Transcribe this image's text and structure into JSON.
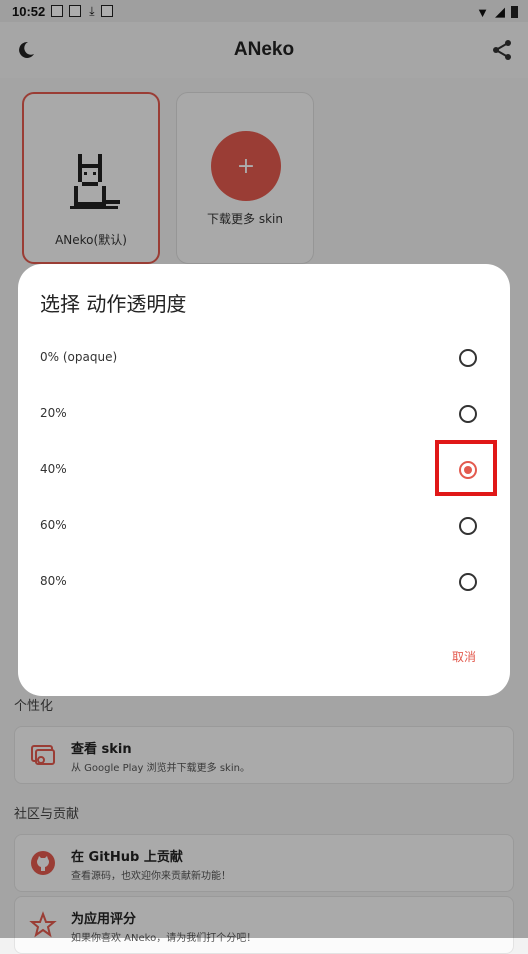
{
  "status_bar": {
    "time": "10:52"
  },
  "app_bar": {
    "title": "ANeko",
    "left_icon": "night-mode-icon",
    "right_icon": "share-icon"
  },
  "skins": [
    {
      "label": "ANeko(默认)",
      "selected": true
    },
    {
      "label": "下载更多 skin",
      "add_symbol": "+"
    }
  ],
  "sections": {
    "personalize": {
      "title": "个性化",
      "items": [
        {
          "title": "查看 skin",
          "subtitle": "从 Google Play 浏览并下载更多 skin。",
          "icon": "skin-browse-icon"
        }
      ]
    },
    "community": {
      "title": "社区与贡献",
      "items": [
        {
          "title": "在 GitHub 上贡献",
          "subtitle": "查看源码，也欢迎你来贡献新功能！",
          "icon": "github-icon"
        },
        {
          "title": "为应用评分",
          "subtitle": "如果你喜欢 ANeko，请为我们打个分吧！",
          "icon": "star-icon"
        }
      ]
    }
  },
  "dialog": {
    "title": "选择 动作透明度",
    "options": [
      {
        "label": "0% (opaque)",
        "checked": false
      },
      {
        "label": "20%",
        "checked": false
      },
      {
        "label": "40%",
        "checked": true
      },
      {
        "label": "60%",
        "checked": false
      },
      {
        "label": "80%",
        "checked": false
      }
    ],
    "cancel_label": "取消"
  },
  "colors": {
    "accent": "#e35a4e",
    "highlight": "#e01818"
  }
}
